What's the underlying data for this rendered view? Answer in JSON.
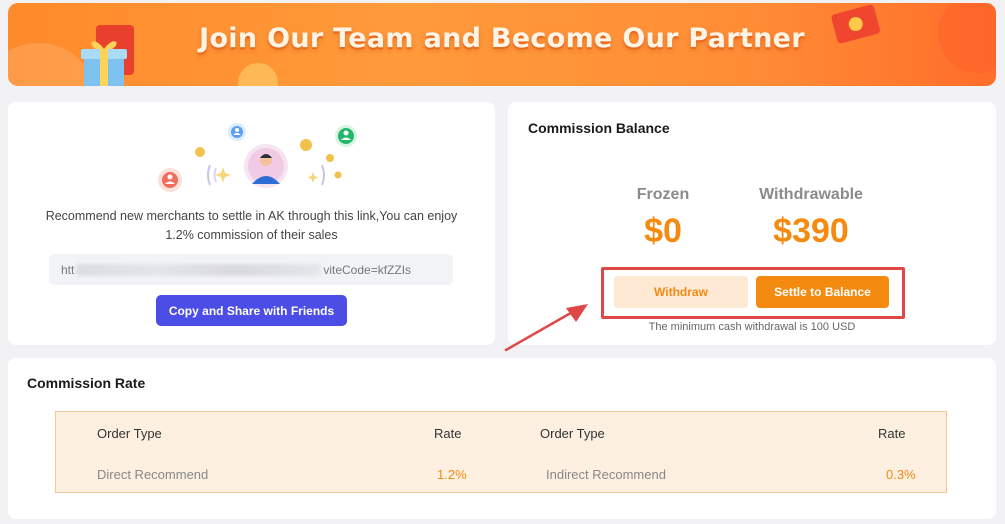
{
  "banner": {
    "title": "Join Our Team and Become Our Partner"
  },
  "invite": {
    "description": "Recommend new merchants to settle in AK through this link,You can enjoy 1.2% commission of their sales",
    "link_start": "htt",
    "link_end": "viteCode=kfZZIs",
    "copy_button_label": "Copy and Share with Friends"
  },
  "balance": {
    "title": "Commission Balance",
    "frozen_label": "Frozen",
    "frozen_value": "$0",
    "withdrawable_label": "Withdrawable",
    "withdrawable_value": "$390",
    "withdraw_label": "Withdraw",
    "settle_label": "Settle to Balance",
    "min_note": "The minimum cash withdrawal is 100 USD",
    "highlight_color": "#e04848"
  },
  "rate": {
    "title": "Commission Rate",
    "headers": [
      "Order Type",
      "Rate",
      "Order Type",
      "Rate"
    ],
    "rows": [
      {
        "type": "Direct Recommend",
        "rate": "1.2%"
      },
      {
        "type": "Indirect Recommend",
        "rate": "0.3%"
      }
    ]
  },
  "colors": {
    "accent_orange": "#f58a10",
    "primary_purple": "#4b4de6",
    "banner_orange": "#ff9a3a"
  },
  "icons": [
    "gift-icon",
    "red-envelope-icon",
    "user-avatar-icon",
    "coin-icon",
    "arrow-annotation-icon"
  ]
}
